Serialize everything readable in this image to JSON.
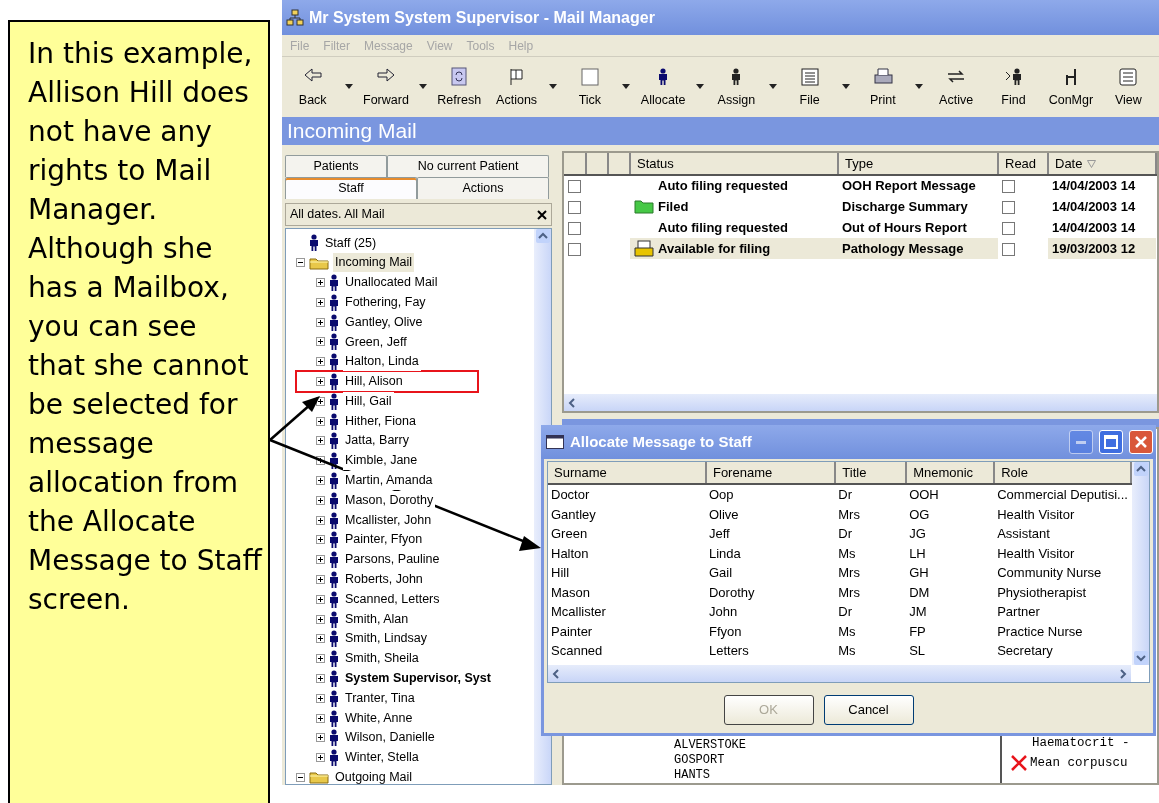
{
  "callout": {
    "text": "In this example, Allison Hill does not have any rights to Mail Manager. Although she has a Mailbox, you can see that she cannot be selected for message allocation from the Allocate Message to Staff screen."
  },
  "window": {
    "title": "Mr System System Supervisor - Mail Manager"
  },
  "menu": [
    {
      "label": "File",
      "disabled": true
    },
    {
      "label": "Filter",
      "disabled": true
    },
    {
      "label": "Message",
      "disabled": true
    },
    {
      "label": "View",
      "disabled": true
    },
    {
      "label": "Tools",
      "disabled": true
    },
    {
      "label": "Help",
      "disabled": true
    }
  ],
  "toolbar": [
    {
      "label": "Back",
      "dropdown": true
    },
    {
      "label": "Forward",
      "dropdown": true
    },
    {
      "label": "Refresh",
      "dropdown": false
    },
    {
      "label": "Actions",
      "dropdown": true
    },
    {
      "label": "Tick",
      "dropdown": true
    },
    {
      "label": "Allocate",
      "dropdown": true
    },
    {
      "label": "Assign",
      "dropdown": true
    },
    {
      "label": "File",
      "dropdown": true
    },
    {
      "label": "Print",
      "dropdown": true
    },
    {
      "label": "Active",
      "dropdown": false
    },
    {
      "label": "Find",
      "dropdown": false
    },
    {
      "label": "ConMgr",
      "dropdown": false
    },
    {
      "label": "View",
      "dropdown": false
    }
  ],
  "view_title": "Incoming Mail",
  "tabs": [
    {
      "label": "Patients",
      "selected": false
    },
    {
      "label": "No current Patient",
      "selected": false
    },
    {
      "label": "Staff",
      "selected": true
    },
    {
      "label": "Actions",
      "selected": false
    }
  ],
  "filter": {
    "text": "All dates. All Mail"
  },
  "tree": [
    {
      "label": "Staff (25)",
      "kind": "person",
      "selected": false
    },
    {
      "label": "Incoming Mail",
      "kind": "folder",
      "expanded": true,
      "selected": true,
      "children": [
        {
          "label": "Unallocated Mail",
          "kind": "person",
          "expanded": false,
          "selected": false,
          "current": false,
          "marked": false
        },
        {
          "label": "Fothering, Fay",
          "kind": "person",
          "expanded": false,
          "selected": false,
          "current": false,
          "marked": false
        },
        {
          "label": "Gantley, Olive",
          "kind": "person",
          "expanded": false,
          "selected": false,
          "current": false,
          "marked": false
        },
        {
          "label": "Green, Jeff",
          "kind": "person",
          "expanded": false,
          "selected": false,
          "current": false,
          "marked": false
        },
        {
          "label": "Halton, Linda",
          "kind": "person",
          "expanded": false,
          "selected": false,
          "current": false,
          "marked": false
        },
        {
          "label": "Hill, Alison",
          "kind": "person",
          "expanded": false,
          "selected": false,
          "current": false,
          "marked": true
        },
        {
          "label": "Hill, Gail",
          "kind": "person",
          "expanded": false,
          "selected": false,
          "current": false,
          "marked": false
        },
        {
          "label": "Hither, Fiona",
          "kind": "person",
          "expanded": false,
          "selected": false,
          "current": false,
          "marked": false
        },
        {
          "label": "Jatta, Barry",
          "kind": "person",
          "expanded": false,
          "selected": false,
          "current": false,
          "marked": false
        },
        {
          "label": "Kimble, Jane",
          "kind": "person",
          "expanded": false,
          "selected": false,
          "current": false,
          "marked": false
        },
        {
          "label": "Martin, Amanda",
          "kind": "person",
          "expanded": false,
          "selected": false,
          "current": false,
          "marked": false
        },
        {
          "label": "Mason, Dorothy",
          "kind": "person",
          "expanded": false,
          "selected": false,
          "current": false,
          "marked": false
        },
        {
          "label": "Mcallister, John",
          "kind": "person",
          "expanded": false,
          "selected": false,
          "current": false,
          "marked": false
        },
        {
          "label": "Painter, Ffyon",
          "kind": "person",
          "expanded": false,
          "selected": false,
          "current": false,
          "marked": false
        },
        {
          "label": "Parsons, Pauline",
          "kind": "person",
          "expanded": false,
          "selected": false,
          "current": false,
          "marked": false
        },
        {
          "label": "Roberts, John",
          "kind": "person",
          "expanded": false,
          "selected": false,
          "current": false,
          "marked": false
        },
        {
          "label": "Scanned, Letters",
          "kind": "person",
          "expanded": false,
          "selected": false,
          "current": false,
          "marked": false
        },
        {
          "label": "Smith, Alan",
          "kind": "person",
          "expanded": false,
          "selected": false,
          "current": false,
          "marked": false
        },
        {
          "label": "Smith, Lindsay",
          "kind": "person",
          "expanded": false,
          "selected": false,
          "current": false,
          "marked": false
        },
        {
          "label": "Smith, Sheila",
          "kind": "person",
          "expanded": false,
          "selected": false,
          "current": false,
          "marked": false
        },
        {
          "label": "System Supervisor, Syst",
          "kind": "person",
          "expanded": false,
          "selected": false,
          "current": true,
          "marked": false
        },
        {
          "label": "Tranter, Tina",
          "kind": "person",
          "expanded": false,
          "selected": false,
          "current": false,
          "marked": false
        },
        {
          "label": "White, Anne",
          "kind": "person",
          "expanded": false,
          "selected": false,
          "current": false,
          "marked": false
        },
        {
          "label": "Wilson, Danielle",
          "kind": "person",
          "expanded": false,
          "selected": false,
          "current": false,
          "marked": false
        },
        {
          "label": "Winter, Stella",
          "kind": "person",
          "expanded": false,
          "selected": false,
          "current": false,
          "marked": false
        }
      ]
    },
    {
      "label": "Outgoing Mail",
      "kind": "folder",
      "expanded": true,
      "selected": false
    }
  ],
  "mail_table": {
    "columns": [
      {
        "label": "Status",
        "sorted": false
      },
      {
        "label": "Type",
        "sorted": false
      },
      {
        "label": "Read",
        "sorted": false
      },
      {
        "label": "Date",
        "sorted": true
      }
    ],
    "rows": [
      {
        "checked": false,
        "kind": "plain",
        "status": "Auto filing requested",
        "type": "OOH Report Message",
        "read": false,
        "date": "14/04/2003 14",
        "selected": false
      },
      {
        "checked": false,
        "kind": "filed",
        "status": "Filed",
        "type": "Discharge Summary",
        "read": false,
        "date": "14/04/2003 14",
        "selected": false
      },
      {
        "checked": false,
        "kind": "plain",
        "status": "Auto filing requested",
        "type": "Out of Hours Report",
        "read": false,
        "date": "14/04/2003 14",
        "selected": false
      },
      {
        "checked": false,
        "kind": "available",
        "status": "Available for filing",
        "type": "Pathology Message",
        "read": false,
        "date": "19/03/2003 12",
        "selected": true
      }
    ]
  },
  "preview": {
    "address": [
      "ALVERSTOKE",
      "GOSPORT",
      "HANTS"
    ],
    "results": [
      {
        "text": "Haematocrit -",
        "kind": "normal"
      },
      {
        "text": "Mean corpuscu",
        "kind": "abnormal"
      }
    ]
  },
  "dialog": {
    "title": "Allocate Message to Staff",
    "columns": [
      "Surname",
      "Forename",
      "Title",
      "Mnemonic",
      "Role"
    ],
    "rows": [
      [
        "Doctor",
        "Oop",
        "Dr",
        "OOH",
        "Commercial Deputisi..."
      ],
      [
        "Gantley",
        "Olive",
        "Mrs",
        "OG",
        "Health Visitor"
      ],
      [
        "Green",
        "Jeff",
        "Dr",
        "JG",
        "Assistant"
      ],
      [
        "Halton",
        "Linda",
        "Ms",
        "LH",
        "Health Visitor"
      ],
      [
        "Hill",
        "Gail",
        "Mrs",
        "GH",
        "Community Nurse"
      ],
      [
        "Mason",
        "Dorothy",
        "Mrs",
        "DM",
        "Physiotherapist"
      ],
      [
        "Mcallister",
        "John",
        "Dr",
        "JM",
        "Partner"
      ],
      [
        "Painter",
        "Ffyon",
        "Ms",
        "FP",
        "Practice Nurse"
      ],
      [
        "Scanned",
        "Letters",
        "Ms",
        "SL",
        "Secretary"
      ]
    ],
    "buttons": [
      {
        "label": "OK",
        "disabled": true
      },
      {
        "label": "Cancel",
        "disabled": false
      }
    ]
  }
}
